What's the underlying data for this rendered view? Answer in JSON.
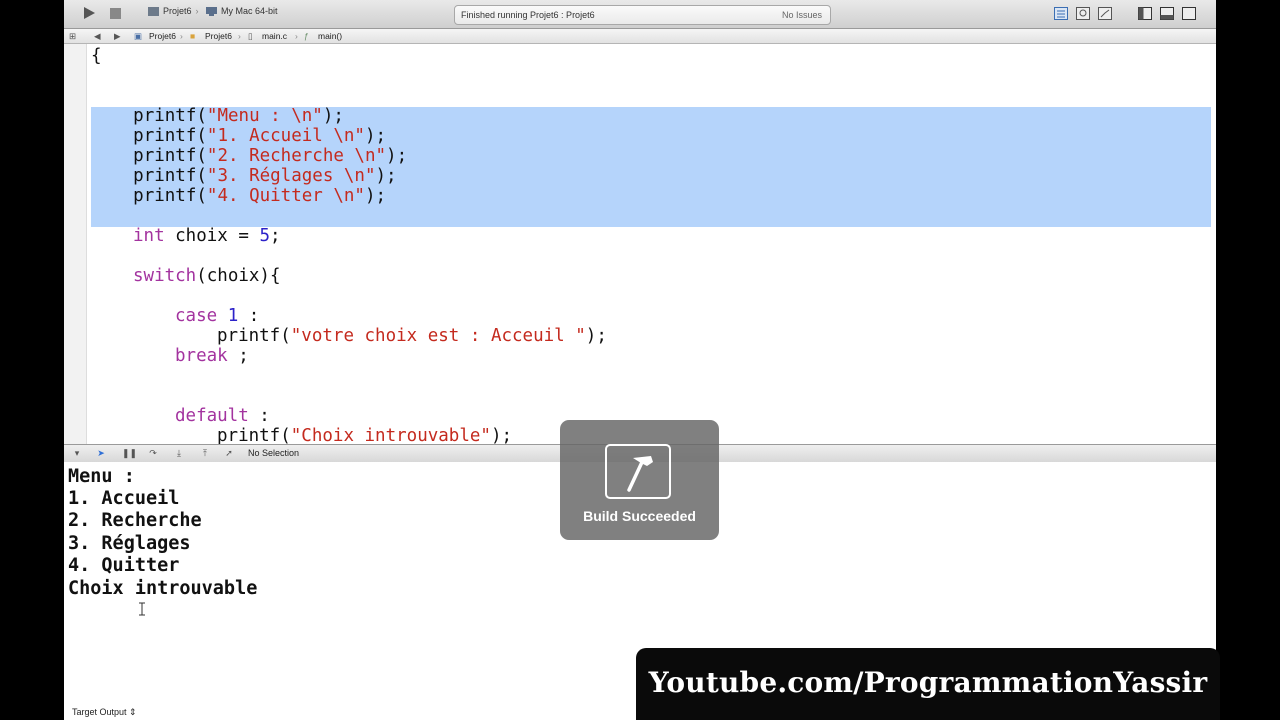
{
  "toolbar": {
    "scheme": "Projet6",
    "destination": "My Mac 64-bit",
    "status_text": "Finished running Projet6 : Projet6",
    "issues_text": "No Issues"
  },
  "jumpbar": {
    "crumbs": [
      "Projet6",
      "Projet6",
      "main.c",
      "main()"
    ]
  },
  "editor": {
    "brace": "{",
    "lines": [
      {
        "indent": "    ",
        "fn": "printf",
        "str": "\"Menu : \\n\"",
        "end": ");"
      },
      {
        "indent": "    ",
        "fn": "printf",
        "str": "\"1. Accueil \\n\"",
        "end": ");"
      },
      {
        "indent": "    ",
        "fn": "printf",
        "str": "\"2. Recherche \\n\"",
        "end": ");"
      },
      {
        "indent": "    ",
        "fn": "printf",
        "str": "\"3. Réglages \\n\"",
        "end": ");"
      },
      {
        "indent": "    ",
        "fn": "printf",
        "str": "\"4. Quitter \\n\"",
        "end": ");"
      }
    ],
    "decl_type": "int",
    "decl_rest": " choix = ",
    "decl_value": "5",
    "decl_end": ";",
    "switch_kw": "switch",
    "switch_rest": "(choix){",
    "case_kw": "case",
    "case_value": "1",
    "case_end": " :",
    "case_call": "printf(",
    "case_str": "\"votre choix est : Acceuil \"",
    "case_call_end": ");",
    "break_kw": "break",
    "break_end": " ;",
    "default_kw": "default",
    "default_end": " :",
    "default_call": "printf(",
    "default_str": "\"Choix introuvable\"",
    "default_call_end": ");"
  },
  "debugbar": {
    "selection_label": "No Selection"
  },
  "console": {
    "output": [
      "Menu :",
      "1. Accueil",
      "2. Recherche",
      "3. Réglages",
      "4. Quitter",
      "Choix introuvable"
    ]
  },
  "statusbar": {
    "target_label": "Target Output ⇕"
  },
  "hud": {
    "label": "Build Succeeded"
  },
  "banner": {
    "text": "Youtube.com/ProgrammationYassir"
  },
  "colors": {
    "selection": "#b5d4fb",
    "keyword": "#a3339f",
    "string": "#c42a1e",
    "number": "#2c22c9"
  }
}
